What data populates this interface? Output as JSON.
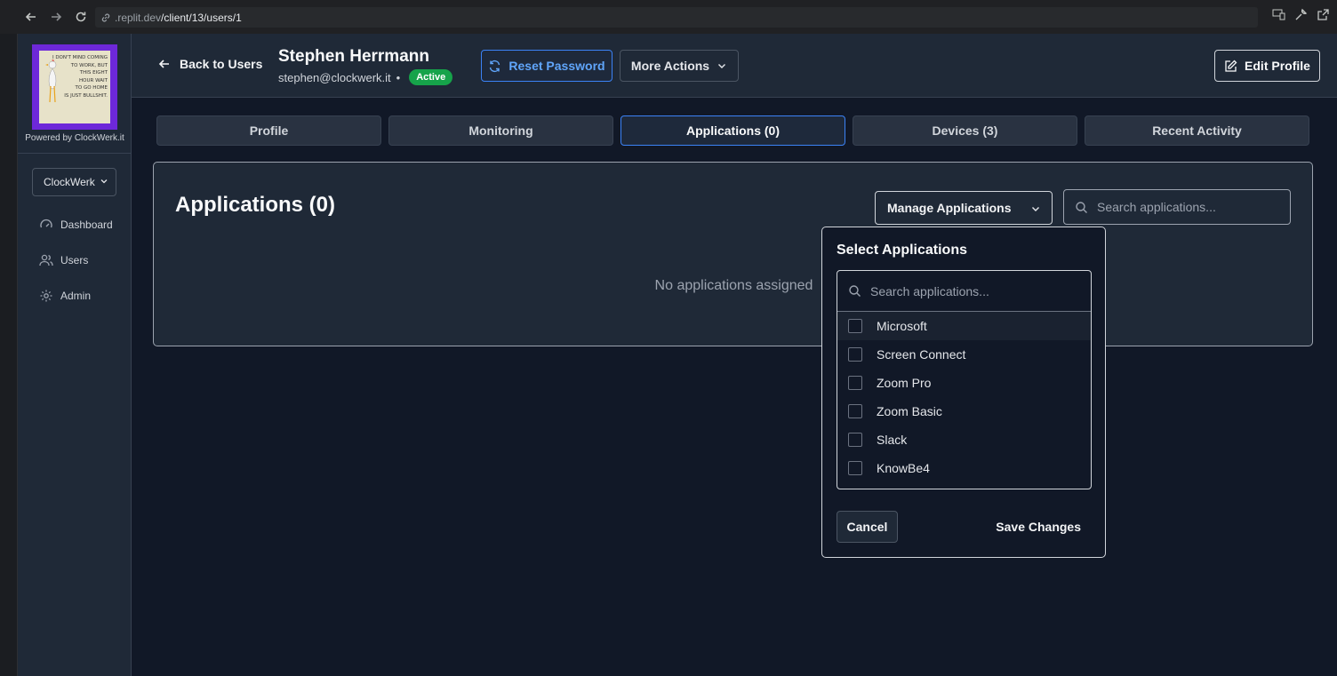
{
  "browser": {
    "url_host": ".replit.dev",
    "url_path": "/client/13/users/1"
  },
  "sidebar": {
    "logo_text": [
      "I DON'T MIND COMING",
      "TO WORK, BUT",
      "THIS EIGHT",
      "HOUR WAIT",
      "TO GO HOME",
      "IS JUST BULLSHIT."
    ],
    "powered_by": "Powered by ClockWerk.it",
    "org_selector": "ClockWerk",
    "items": [
      {
        "label": "Dashboard",
        "icon": "gauge-icon"
      },
      {
        "label": "Users",
        "icon": "users-icon"
      },
      {
        "label": "Admin",
        "icon": "gear-icon"
      }
    ]
  },
  "header": {
    "back_label": "Back to Users",
    "user_name": "Stephen Herrmann",
    "user_email": "stephen@clockwerk.it",
    "separator": "•",
    "status": "Active",
    "reset_password": "Reset Password",
    "more_actions": "More Actions",
    "edit_profile": "Edit Profile"
  },
  "tabs": [
    {
      "label": "Profile",
      "active": false
    },
    {
      "label": "Monitoring",
      "active": false
    },
    {
      "label": "Applications (0)",
      "active": true
    },
    {
      "label": "Devices (3)",
      "active": false
    },
    {
      "label": "Recent Activity",
      "active": false
    }
  ],
  "panel": {
    "title": "Applications (0)",
    "manage_label": "Manage Applications",
    "search_placeholder": "Search applications...",
    "empty_text": "No applications assigned"
  },
  "dropdown": {
    "title": "Select Applications",
    "search_placeholder": "Search applications...",
    "options": [
      {
        "label": "Microsoft",
        "checked": false
      },
      {
        "label": "Screen Connect",
        "checked": false
      },
      {
        "label": "Zoom Pro",
        "checked": false
      },
      {
        "label": "Zoom Basic",
        "checked": false
      },
      {
        "label": "Slack",
        "checked": false
      },
      {
        "label": "KnowBe4",
        "checked": false
      }
    ],
    "cancel_label": "Cancel",
    "save_label": "Save Changes"
  },
  "colors": {
    "background": "#111827",
    "accent": "#3b82f6",
    "status_active": "#16a34a",
    "logo_frame": "#6d28d9"
  }
}
